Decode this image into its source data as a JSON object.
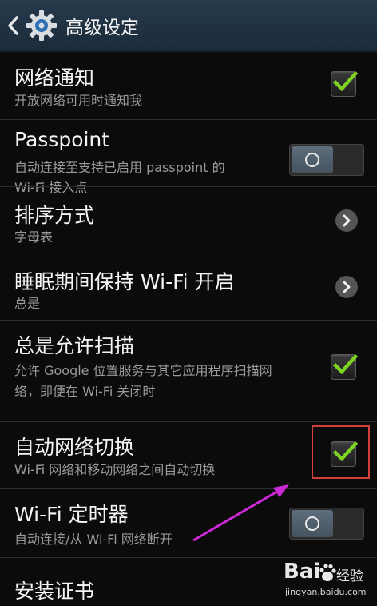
{
  "header": {
    "title": "高级设定",
    "back_icon": "chevron-left-icon",
    "app_icon": "gear-icon"
  },
  "settings": [
    {
      "title": "网络通知",
      "subtitle": "开放网络可用时通知我",
      "control": "checkbox",
      "checked": true
    },
    {
      "title": "Passpoint",
      "subtitle_line1": "自动连接至支持已启用 passpoint 的",
      "subtitle_line2": "Wi-Fi 接入点",
      "control": "switch",
      "on": false
    },
    {
      "title": "排序方式",
      "subtitle": "字母表",
      "control": "chevron"
    },
    {
      "title": "睡眠期间保持 Wi-Fi 开启",
      "subtitle": "总是",
      "control": "chevron"
    },
    {
      "title": "总是允许扫描",
      "subtitle_line1": "允许 Google 位置服务与其它应用程序扫描网",
      "subtitle_line2": "络，即便在 Wi-Fi 关闭时",
      "control": "checkbox",
      "checked": true
    },
    {
      "title": "自动网络切换",
      "subtitle": "Wi-Fi 网络和移动网络之间自动切换",
      "control": "checkbox",
      "checked": true
    },
    {
      "title": "Wi-Fi 定时器",
      "subtitle": "自动连接/从 Wi-Fi 网络断开",
      "control": "switch",
      "on": false
    },
    {
      "title": "安装证书"
    }
  ],
  "annotation": {
    "highlight_color": "#d63d3d",
    "arrow_color": "#cc2ad6"
  },
  "watermark": {
    "logo": "Bai",
    "logo_tail": "经验",
    "url": "jingyan.baidu.com"
  },
  "colors": {
    "check": "#7ed321",
    "background": "#0b0b0b",
    "actionbar": "#1f3142"
  }
}
